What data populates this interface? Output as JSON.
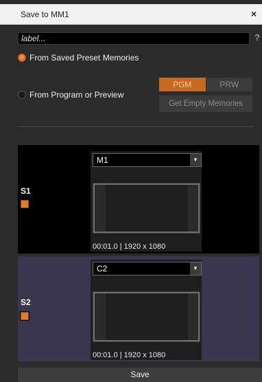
{
  "dialog": {
    "title": "Save to MM1",
    "close_glyph": "×"
  },
  "label_field": {
    "placeholder": "label...",
    "value": ""
  },
  "help_glyph": "?",
  "source_options": [
    {
      "label": "From Saved Preset Memories",
      "selected": true
    },
    {
      "label": "From Program or Preview",
      "selected": false
    }
  ],
  "bus_toggle": {
    "pgm_label": "PGM",
    "prw_label": "PRW",
    "active": "PGM"
  },
  "get_empty_label": "Get Empty Memories",
  "slots": [
    {
      "name": "S1",
      "checked": true,
      "memory": "M1",
      "meta": "00:01.0 | 1920 x 1080",
      "background": "#000000"
    },
    {
      "name": "S2",
      "checked": true,
      "memory": "C2",
      "meta": "00:01.0 | 1920 x 1080",
      "background": "#3a3650"
    }
  ],
  "save_label": "Save",
  "colors": {
    "accent_orange": "#e07a2e",
    "pgm_active": "#c66a22",
    "panel_bg": "#2b2b2b"
  },
  "icons": {
    "close": "close-icon",
    "help": "help-icon",
    "dropdown": "chevron-down-icon"
  }
}
